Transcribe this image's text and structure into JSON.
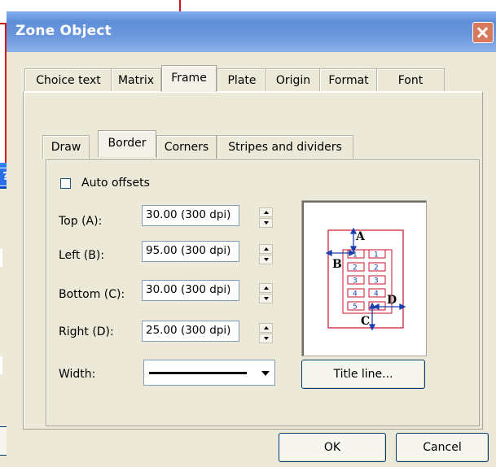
{
  "dialog": {
    "title": "Zone Object",
    "outer_tabs": [
      "Choice text",
      "Matrix",
      "Frame",
      "Plate",
      "Origin",
      "Format",
      "Font"
    ],
    "active_outer_tab": "Frame",
    "inner_tabs": [
      "Draw",
      "Border",
      "Corners",
      "Stripes and dividers"
    ],
    "active_inner_tab": "Border"
  },
  "border": {
    "auto_offsets_label": "Auto offsets",
    "auto_offsets_checked": false,
    "fields": [
      {
        "label": "Top (A):",
        "value": "30.00 (300 dpi)"
      },
      {
        "label": "Left (B):",
        "value": "95.00 (300 dpi)"
      },
      {
        "label": "Bottom (C):",
        "value": "30.00 (300 dpi)"
      },
      {
        "label": "Right (D):",
        "value": "25.00 (300 dpi)"
      }
    ],
    "width_label": "Width:",
    "title_line_button": "Title line...",
    "preview": {
      "label_a": "A",
      "label_b": "B",
      "label_c": "C",
      "label_d": "D",
      "cells": [
        "1",
        "2",
        "3",
        "4",
        "5"
      ]
    }
  },
  "footer": {
    "ok_label": "OK",
    "cancel_label": "Cancel"
  },
  "colors": {
    "title_gradient": "#6a97de",
    "diagram_red": "#c8102e",
    "diagram_blue": "#1a3fb0",
    "xp_blue": "#0a4ed8"
  }
}
